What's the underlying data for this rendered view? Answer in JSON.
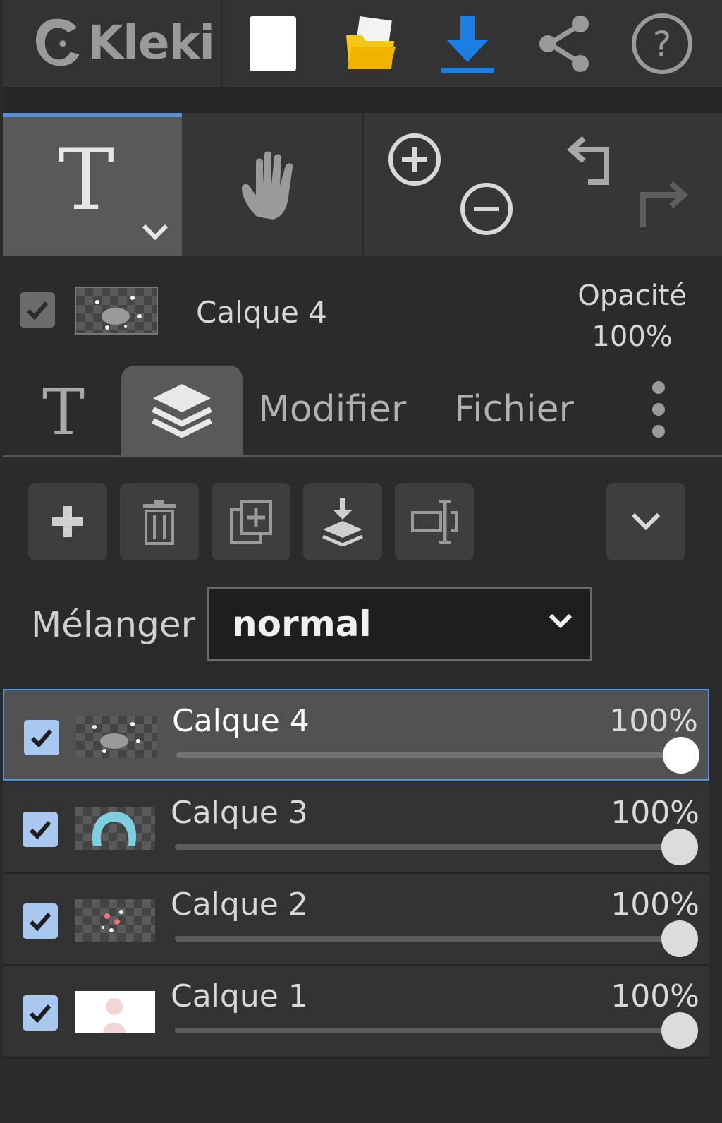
{
  "app": {
    "name": "Kleki"
  },
  "toolbar": {
    "new_icon": "new-document-icon",
    "open_icon": "open-folder-icon",
    "save_icon": "download-icon",
    "share_icon": "share-icon",
    "help_icon": "help-icon"
  },
  "tools": {
    "active_tool_glyph": "T",
    "hand_icon": "hand-icon",
    "zoom_in_icon": "zoom-in-icon",
    "zoom_out_icon": "zoom-out-icon",
    "undo_icon": "undo-icon",
    "redo_icon": "redo-icon"
  },
  "current_layer": {
    "name": "Calque 4",
    "opacity_label": "Opacité",
    "opacity_value": "100%"
  },
  "tabs": {
    "text_tab_glyph": "T",
    "layers_tab_icon": "layers-icon",
    "modifier": "Modifier",
    "fichier": "Fichier"
  },
  "layer_actions": {
    "add_icon": "plus-icon",
    "delete_icon": "trash-icon",
    "duplicate_icon": "duplicate-icon",
    "merge_icon": "merge-down-icon",
    "rename_icon": "rename-icon",
    "more_icon": "chevron-down-icon"
  },
  "blend": {
    "label": "Mélanger",
    "value": "normal"
  },
  "layers": [
    {
      "name": "Calque 4",
      "opacity": "100%",
      "visible": true,
      "selected": true
    },
    {
      "name": "Calque 3",
      "opacity": "100%",
      "visible": true,
      "selected": false
    },
    {
      "name": "Calque 2",
      "opacity": "100%",
      "visible": true,
      "selected": false
    },
    {
      "name": "Calque 1",
      "opacity": "100%",
      "visible": true,
      "selected": false
    }
  ],
  "colors": {
    "accent": "#5b8fd8",
    "download": "#1a7fe0",
    "folder": "#f5c518",
    "checkbox": "#a8c8f0"
  }
}
